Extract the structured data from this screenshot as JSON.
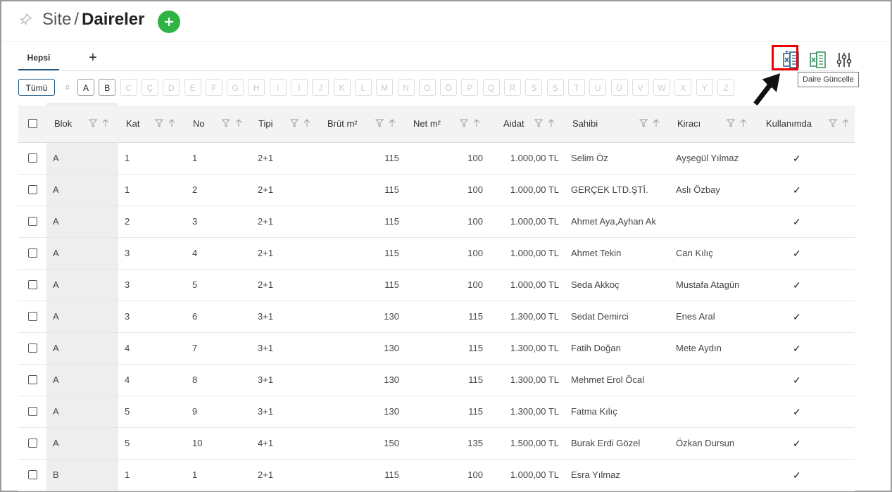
{
  "header": {
    "section": "Site",
    "separator": "/",
    "title": "Daireler"
  },
  "tabs": [
    {
      "label": "Hepsi"
    }
  ],
  "toolbar": {
    "tooltip": "Daire Güncelle"
  },
  "filter": {
    "all_label": "Tümü",
    "hash": "#",
    "letters": [
      "A",
      "B",
      "C",
      "Ç",
      "D",
      "E",
      "F",
      "G",
      "H",
      "I",
      "İ",
      "J",
      "K",
      "L",
      "M",
      "N",
      "O",
      "Ö",
      "P",
      "Q",
      "R",
      "S",
      "Ş",
      "T",
      "U",
      "Ü",
      "V",
      "W",
      "X",
      "Y",
      "Z"
    ],
    "enabled": [
      "A",
      "B"
    ]
  },
  "table": {
    "columns": [
      "Blok",
      "Kat",
      "No",
      "Tipi",
      "Brüt m²",
      "Net m²",
      "Aidat",
      "Sahibi",
      "Kiracı",
      "Kullanımda"
    ],
    "rows": [
      {
        "blok": "A",
        "kat": "1",
        "no": "1",
        "tipi": "2+1",
        "brut": "115",
        "net": "100",
        "aidat": "1.000,00 TL",
        "sahibi": "Selim Öz",
        "kiraci": "Ayşegül Yılmaz",
        "kullanimda": "✓"
      },
      {
        "blok": "A",
        "kat": "1",
        "no": "2",
        "tipi": "2+1",
        "brut": "115",
        "net": "100",
        "aidat": "1.000,00 TL",
        "sahibi": "GERÇEK LTD.ŞTİ.",
        "kiraci": "Aslı Özbay",
        "kullanimda": "✓"
      },
      {
        "blok": "A",
        "kat": "2",
        "no": "3",
        "tipi": "2+1",
        "brut": "115",
        "net": "100",
        "aidat": "1.000,00 TL",
        "sahibi": "Ahmet Aya,Ayhan Ak",
        "kiraci": "",
        "kullanimda": "✓"
      },
      {
        "blok": "A",
        "kat": "3",
        "no": "4",
        "tipi": "2+1",
        "brut": "115",
        "net": "100",
        "aidat": "1.000,00 TL",
        "sahibi": "Ahmet Tekin",
        "kiraci": "Can Kılıç",
        "kullanimda": "✓"
      },
      {
        "blok": "A",
        "kat": "3",
        "no": "5",
        "tipi": "2+1",
        "brut": "115",
        "net": "100",
        "aidat": "1.000,00 TL",
        "sahibi": "Seda Akkoç",
        "kiraci": "Mustafa Atagün",
        "kullanimda": "✓"
      },
      {
        "blok": "A",
        "kat": "3",
        "no": "6",
        "tipi": "3+1",
        "brut": "130",
        "net": "115",
        "aidat": "1.300,00 TL",
        "sahibi": "Sedat Demirci",
        "kiraci": "Enes Aral",
        "kullanimda": "✓"
      },
      {
        "blok": "A",
        "kat": "4",
        "no": "7",
        "tipi": "3+1",
        "brut": "130",
        "net": "115",
        "aidat": "1.300,00 TL",
        "sahibi": "Fatih Doğan",
        "kiraci": "Mete Aydın",
        "kullanimda": "✓"
      },
      {
        "blok": "A",
        "kat": "4",
        "no": "8",
        "tipi": "3+1",
        "brut": "130",
        "net": "115",
        "aidat": "1.300,00 TL",
        "sahibi": "Mehmet Erol Öcal",
        "kiraci": "",
        "kullanimda": "✓"
      },
      {
        "blok": "A",
        "kat": "5",
        "no": "9",
        "tipi": "3+1",
        "brut": "130",
        "net": "115",
        "aidat": "1.300,00 TL",
        "sahibi": "Fatma Kılıç",
        "kiraci": "",
        "kullanimda": "✓"
      },
      {
        "blok": "A",
        "kat": "5",
        "no": "10",
        "tipi": "4+1",
        "brut": "150",
        "net": "135",
        "aidat": "1.500,00 TL",
        "sahibi": "Burak Erdi Gözel",
        "kiraci": "Özkan Dursun",
        "kullanimda": "✓"
      },
      {
        "blok": "B",
        "kat": "1",
        "no": "1",
        "tipi": "2+1",
        "brut": "115",
        "net": "100",
        "aidat": "1.000,00 TL",
        "sahibi": "Esra Yılmaz",
        "kiraci": "",
        "kullanimda": "✓"
      }
    ]
  }
}
